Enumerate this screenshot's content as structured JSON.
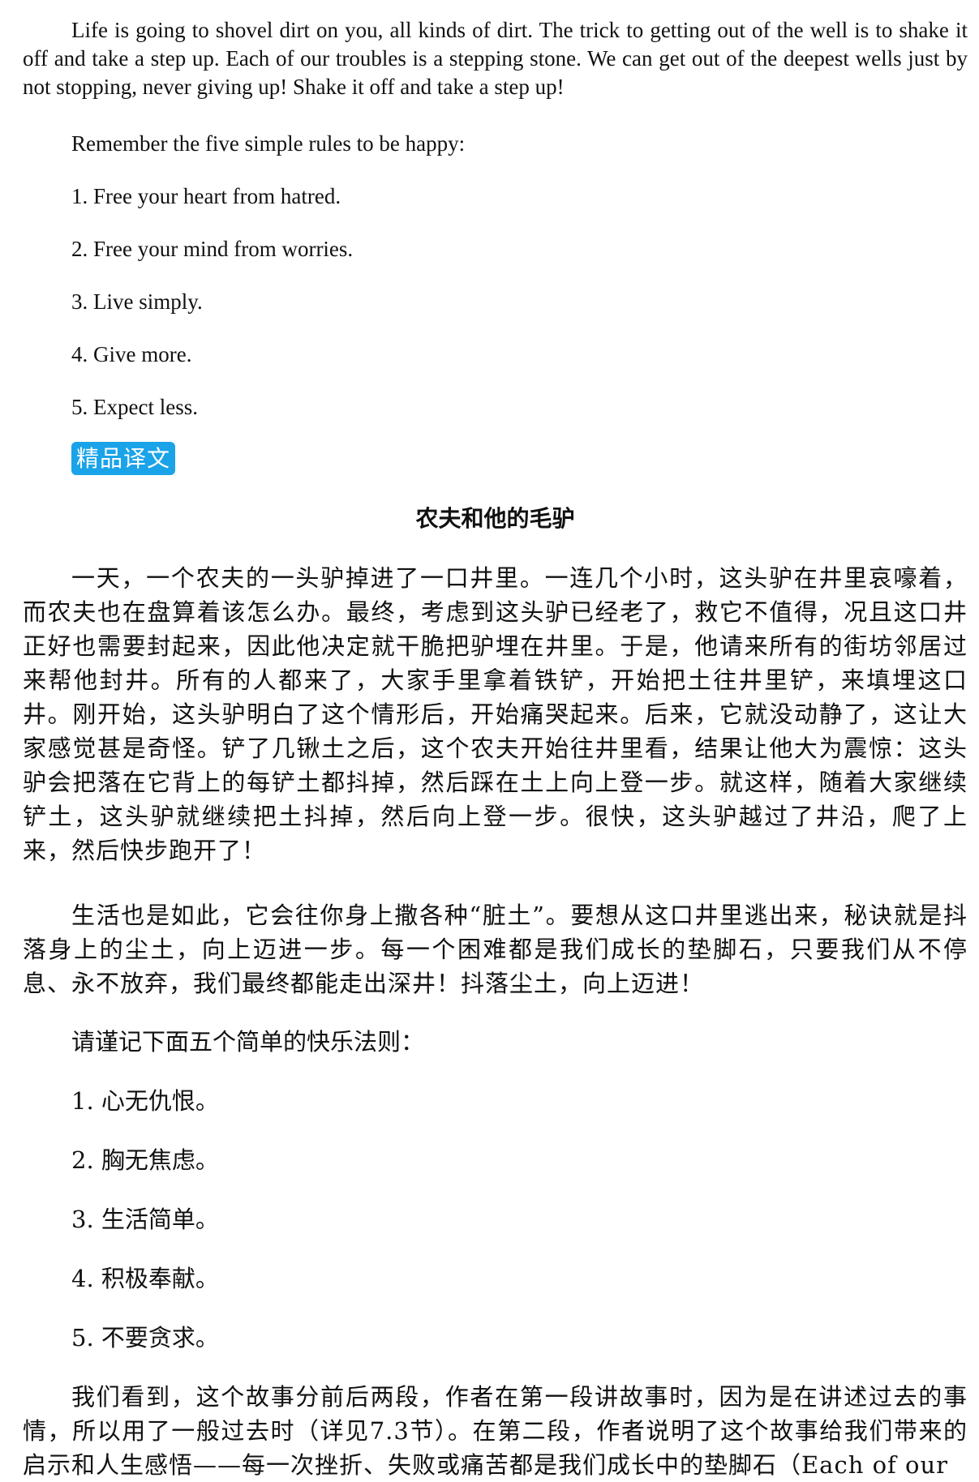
{
  "english": {
    "paragraph": "Life is going to shovel dirt on you, all kinds of dirt. The trick to getting out of the well is to shake it off and take a step up. Each of our troubles is a stepping stone. We can get out of the deepest wells just by not stopping, never giving up! Shake it off and take a step up!",
    "rules_intro": "Remember the five simple rules to be happy:",
    "rules": [
      "1. Free your heart from hatred.",
      "2. Free your mind from worries.",
      "3. Live simply.",
      "4. Give more.",
      "5. Expect less."
    ]
  },
  "section_tag": "精品译文",
  "chinese": {
    "title": "农夫和他的毛驴",
    "paragraph1": "一天，一个农夫的一头驴掉进了一口井里。一连几个小时，这头驴在井里哀嚎着，而农夫也在盘算着该怎么办。最终，考虑到这头驴已经老了，救它不值得，况且这口井正好也需要封起来，因此他决定就干脆把驴埋在井里。于是，他请来所有的街坊邻居过来帮他封井。所有的人都来了，大家手里拿着铁铲，开始把土往井里铲，来填埋这口井。刚开始，这头驴明白了这个情形后，开始痛哭起来。后来，它就没动静了，这让大家感觉甚是奇怪。铲了几锹土之后，这个农夫开始往井里看，结果让他大为震惊：这头驴会把落在它背上的每铲土都抖掉，然后踩在土上向上登一步。就这样，随着大家继续铲土，这头驴就继续把土抖掉，然后向上登一步。很快，这头驴越过了井沿，爬了上来，然后快步跑开了！",
    "paragraph2": "生活也是如此，它会往你身上撒各种“脏土”。要想从这口井里逃出来，秘诀就是抖落身上的尘土，向上迈进一步。每一个困难都是我们成长的垫脚石，只要我们从不停息、永不放弃，我们最终都能走出深井！抖落尘土，向上迈进！",
    "rules_intro": "请谨记下面五个简单的快乐法则：",
    "rules": [
      "1. 心无仇恨。",
      "2. 胸无焦虑。",
      "3. 生活简单。",
      "4. 积极奉献。",
      "5. 不要贪求。"
    ],
    "paragraph3": "我们看到，这个故事分前后两段，作者在第一段讲故事时，因为是在讲述过去的事情，所以用了一般过去时（详见7.3节）。在第二段，作者说明了这个故事给我们带来的启示和人生感悟——每一次挫折、失败或痛苦都是我们成长中的垫脚石（Each of our"
  }
}
